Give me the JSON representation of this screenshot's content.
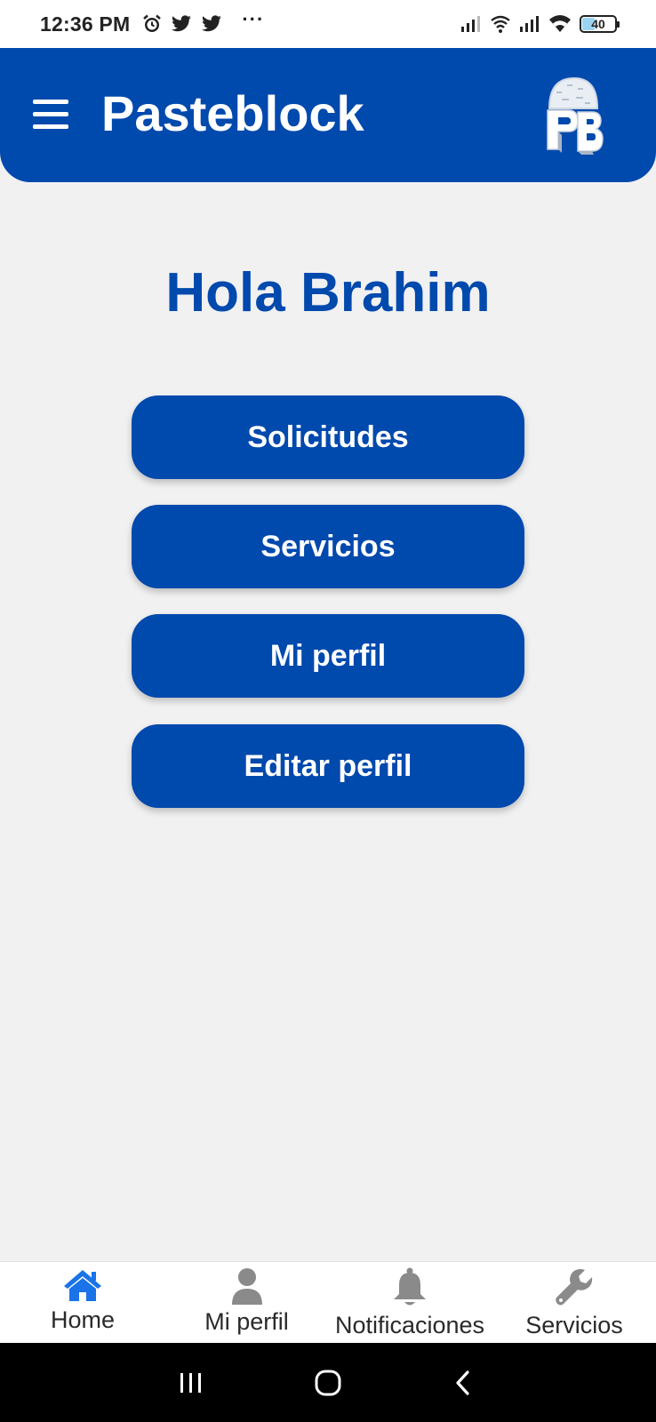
{
  "status_bar": {
    "time": "12:36 PM",
    "more": "···",
    "battery_level": "40",
    "icons": [
      "alarm-icon",
      "twitter-icon",
      "twitter-icon",
      "signal-icon",
      "wifi-calling-icon",
      "signal-icon",
      "wifi-icon",
      "battery-icon"
    ]
  },
  "header": {
    "title": "Pasteblock",
    "menu_icon": "hamburger-menu-icon",
    "logo": "pasteblock-logo"
  },
  "main": {
    "greeting": "Hola Brahim",
    "buttons": [
      {
        "label": "Solicitudes"
      },
      {
        "label": "Servicios"
      },
      {
        "label": "Mi perfil"
      },
      {
        "label": "Editar perfil"
      }
    ]
  },
  "bottom_nav": {
    "items": [
      {
        "label": "Home",
        "icon": "home-icon",
        "active": true
      },
      {
        "label": "Mi perfil",
        "icon": "user-icon",
        "active": false
      },
      {
        "label": "Notificaciones",
        "icon": "bell-icon",
        "active": false
      },
      {
        "label": "Servicios",
        "icon": "wrench-icon",
        "active": false
      }
    ]
  },
  "system_nav": {
    "icons": [
      "recents-icon",
      "home-circle-icon",
      "back-icon"
    ]
  },
  "colors": {
    "primary": "#0049ad",
    "background": "#f1f1f2",
    "active_nav": "#1a73e8",
    "inactive_nav": "#8a8a8a"
  }
}
